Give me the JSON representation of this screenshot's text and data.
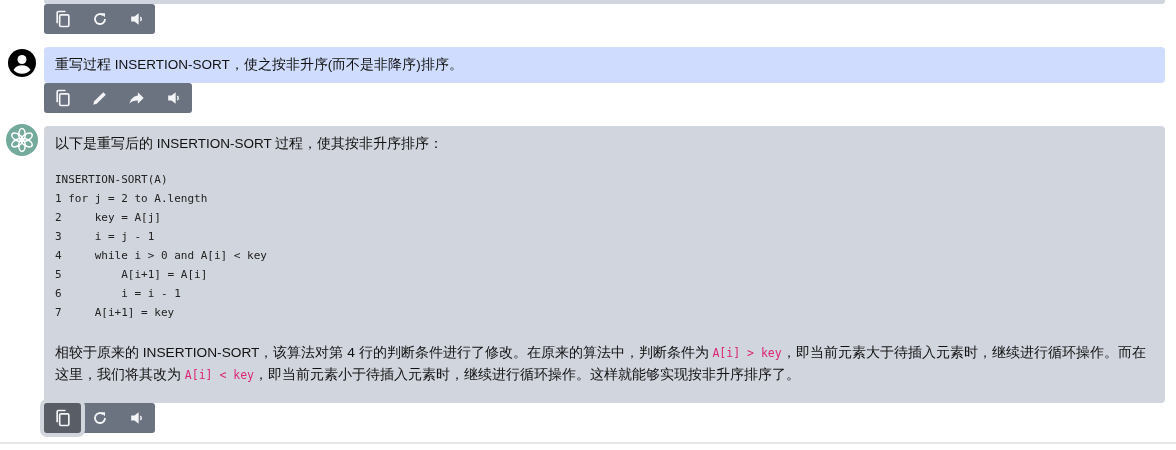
{
  "messages": [
    {
      "kind": "assistant",
      "actions": [
        {
          "kind": "copy",
          "pressed": false
        },
        {
          "kind": "regenerate",
          "pressed": false
        },
        {
          "kind": "speak",
          "pressed": false
        }
      ]
    },
    {
      "kind": "user",
      "text": "重写过程 INSERTION-SORT，使之按非升序(而不是非降序)排序。",
      "actions": [
        {
          "kind": "copy",
          "pressed": false
        },
        {
          "kind": "edit",
          "pressed": false
        },
        {
          "kind": "share",
          "pressed": false
        },
        {
          "kind": "speak",
          "pressed": false
        }
      ]
    },
    {
      "kind": "assistant",
      "intro": "以下是重写后的 INSERTION-SORT 过程，使其按非升序排序：",
      "code": [
        "INSERTION-SORT(A)",
        "1 for j = 2 to A.length",
        "2     key = A[j]",
        "3     i = j - 1",
        "4     while i > 0 and A[i] < key",
        "5         A[i+1] = A[i]",
        "6         i = i - 1",
        "7     A[i+1] = key"
      ],
      "paragraph": [
        {
          "kind": "text",
          "text": "相较于原来的 INSERTION-SORT，该算法对第 4 行的判断条件进行了修改。在原来的算法中，判断条件为 "
        },
        {
          "kind": "code",
          "text": "A[i] > key"
        },
        {
          "kind": "text",
          "text": "，即当前元素大于待插入元素时，继续进行循环操作。而在这里，我们将其改为 "
        },
        {
          "kind": "code",
          "text": "A[i] < key"
        },
        {
          "kind": "text",
          "text": "，即当前元素小于待插入元素时，继续进行循环操作。这样就能够实现按非升序排序了。"
        }
      ],
      "actions": [
        {
          "kind": "copy",
          "pressed": true
        },
        {
          "kind": "regenerate",
          "pressed": false
        },
        {
          "kind": "speak",
          "pressed": false
        }
      ]
    }
  ]
}
